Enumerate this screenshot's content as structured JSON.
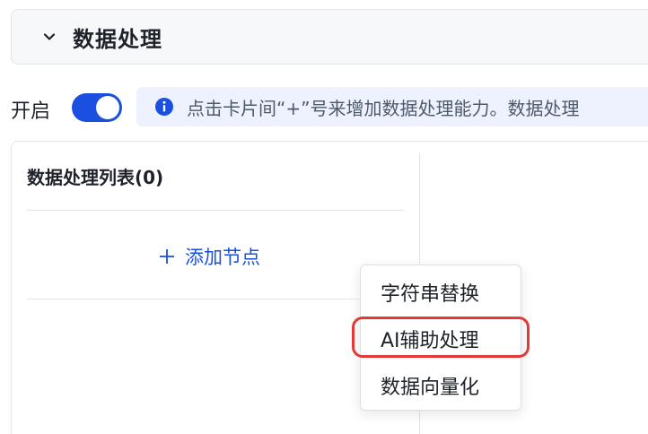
{
  "section": {
    "title": "数据处理"
  },
  "toggle": {
    "label": "开启",
    "state": "on"
  },
  "info": {
    "text": "点击卡片间“+”号来增加数据处理能力。数据处理"
  },
  "panel": {
    "list_title": "数据处理列表(0)",
    "add_node_label": "添加节点"
  },
  "dropdown": {
    "items": [
      {
        "label": "字符串替换"
      },
      {
        "label": "AI辅助处理"
      },
      {
        "label": "数据向量化"
      }
    ]
  },
  "colors": {
    "accent": "#1a4fe0",
    "highlight": "#e53935",
    "banner_bg": "#edf2fe"
  },
  "icons": [
    "chevron-down-icon",
    "info-icon",
    "plus-icon"
  ]
}
